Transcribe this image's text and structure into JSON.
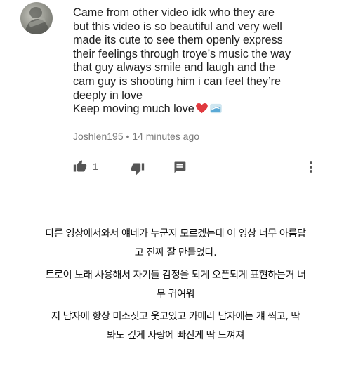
{
  "comment": {
    "lines": [
      "Came from other video idk who they are",
      "but this video is so beautiful and very well",
      "made its cute to see them openly express",
      "their feelings through troye’s music the way",
      "that guy always smile and laugh and the",
      "cam guy is shooting him i can feel they’re",
      "deeply in love",
      "Keep moving much love"
    ],
    "emojis": [
      "red-heart",
      "wave"
    ],
    "author": "Joshlen195",
    "separator": "•",
    "time": "14 minutes ago"
  },
  "actions": {
    "like_count": "1",
    "icons": [
      "thumbs-up-icon",
      "thumbs-down-icon",
      "reply-comment-icon",
      "more-vert-icon"
    ]
  },
  "translation": {
    "paragraphs": [
      [
        "다른 영상에서와서 얘네가 누군지 모르겠는데 이 영상 너무 아름답",
        "고 진짜 잘 만들었다."
      ],
      [
        "트로이 노래 사용해서 자기들 감정을 되게 오픈되게 표현하는거 너",
        "무 귀여워"
      ],
      [
        "저 남자애  항상 미소짓고 웃고있고 카메라 남자애는 걔 찍고, 딱",
        "봐도 깊게 사랑에 빠진게 딱 느껴져"
      ]
    ]
  }
}
